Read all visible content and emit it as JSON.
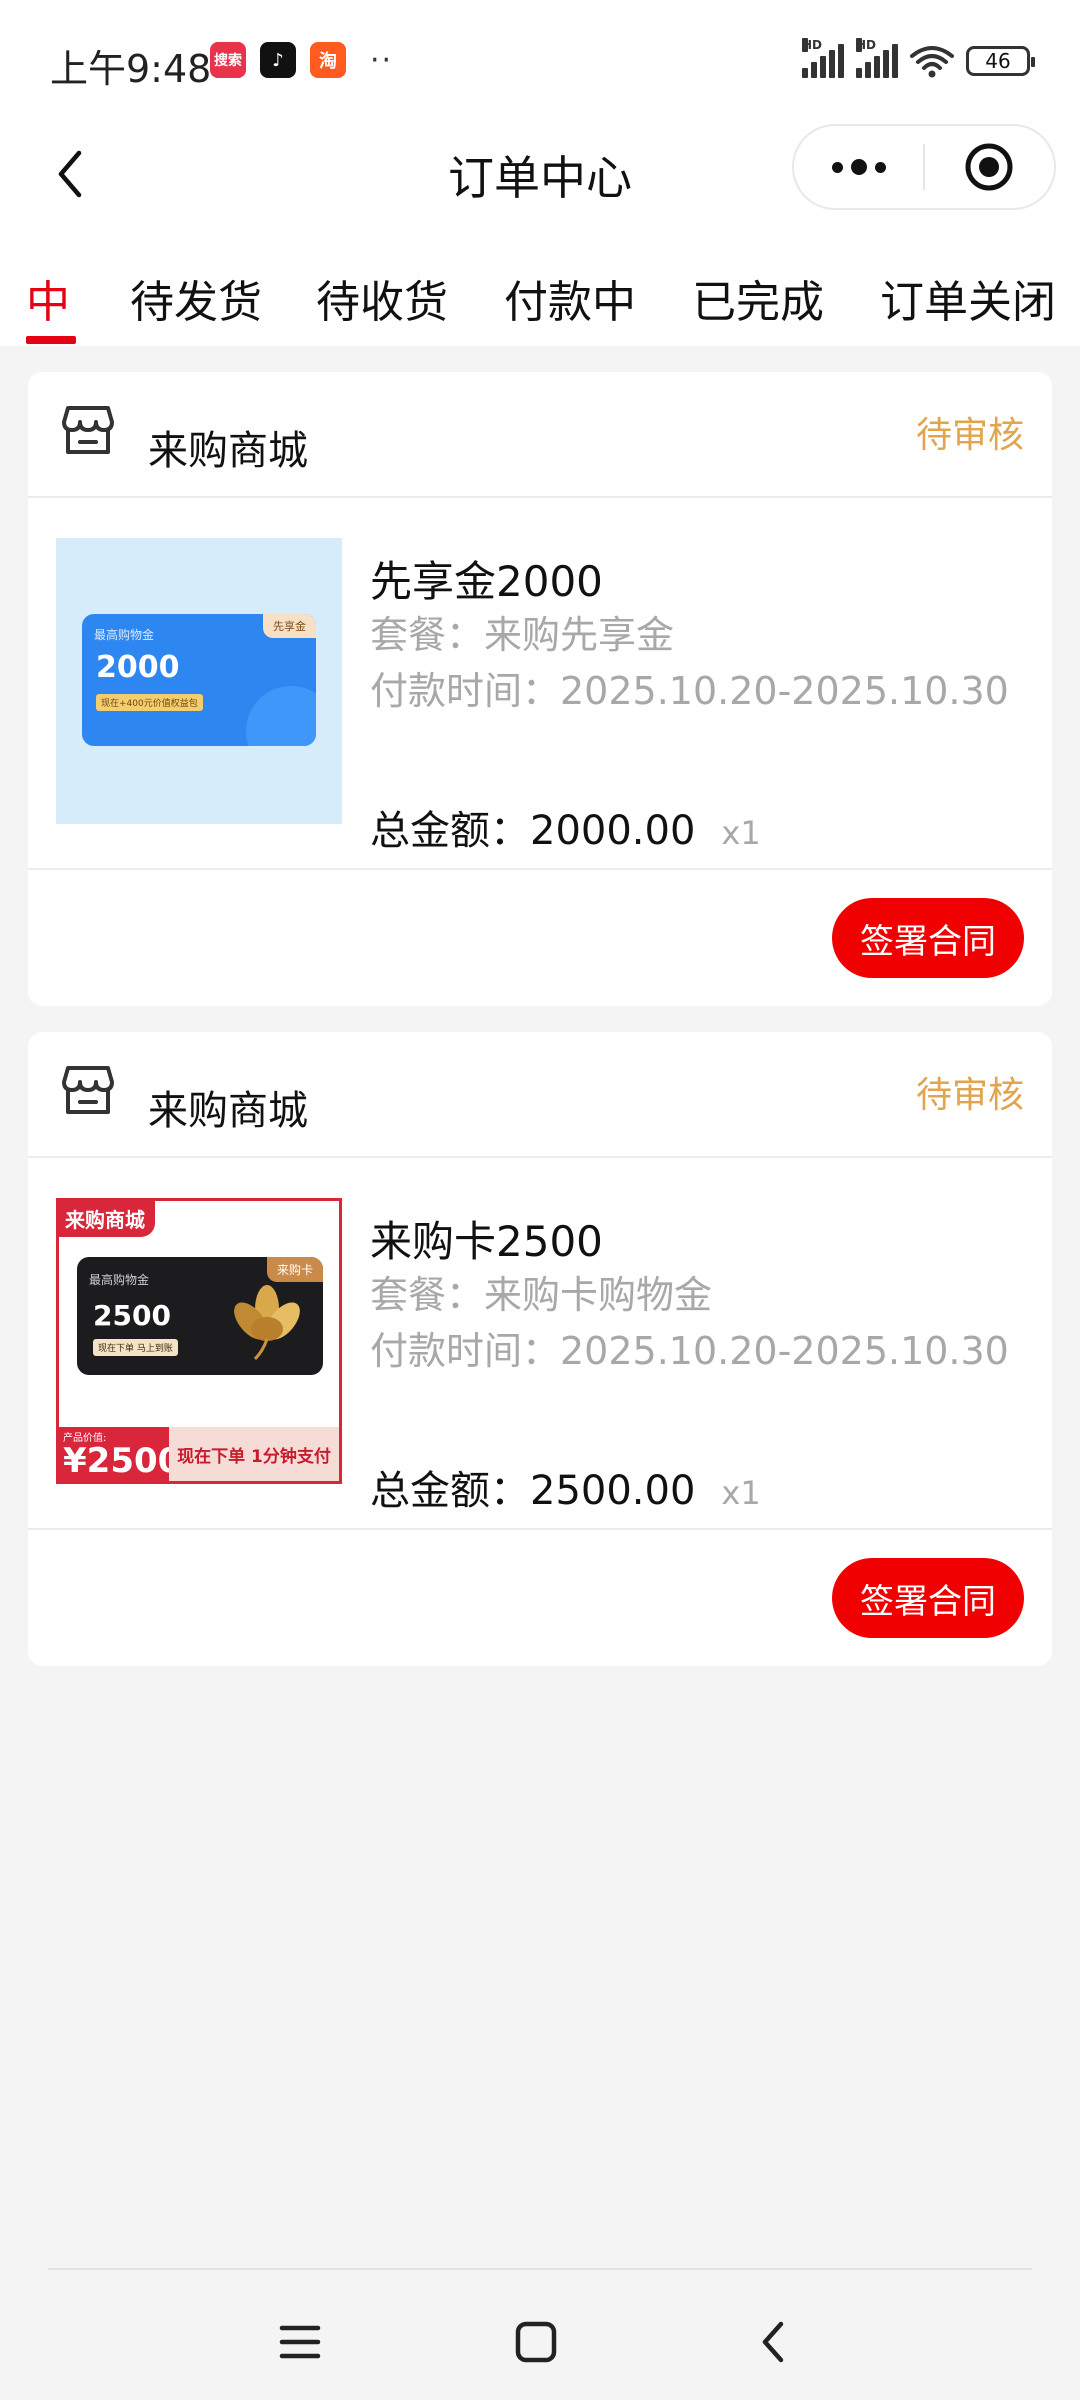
{
  "status_bar": {
    "time": "上午9:48",
    "apps": [
      {
        "icon": "search-app-icon",
        "label": "搜索",
        "color": "#e8334a"
      },
      {
        "icon": "tiktok-icon",
        "label": "♪",
        "color": "#111111"
      },
      {
        "icon": "taobao-icon",
        "label": "淘",
        "color": "#ff5a1f"
      }
    ],
    "more": "··",
    "signal1": "HD",
    "signal2": "HD",
    "battery": "46"
  },
  "header": {
    "back_icon": "back-chevron-icon",
    "title": "订单中心",
    "more_icon": "more-dots-icon",
    "target_icon": "target-circle-icon"
  },
  "tabs": [
    {
      "label": "中",
      "active": true
    },
    {
      "label": "待发货",
      "active": false
    },
    {
      "label": "待收货",
      "active": false
    },
    {
      "label": "付款中",
      "active": false
    },
    {
      "label": "已完成",
      "active": false
    },
    {
      "label": "订单关闭",
      "active": false
    }
  ],
  "orders": [
    {
      "store": "来购商城",
      "status": "待审核",
      "title": "先享金2000",
      "package": "套餐：来购先享金",
      "pay_time": "付款时间：2025.10.20-2025.10.30",
      "total": "总金额：2000.00",
      "qty": "x1",
      "action": "签署合同",
      "thumb": {
        "brand": "最高购物金",
        "amount": "2000",
        "strip": "现在+400元价值权益包",
        "tag": "先享金"
      }
    },
    {
      "store": "来购商城",
      "status": "待审核",
      "title": "来购卡2500",
      "package": "套餐：来购卡购物金",
      "pay_time": "付款时间：2025.10.20-2025.10.30",
      "total": "总金额：2500.00",
      "qty": "x1",
      "action": "签署合同",
      "thumb": {
        "corner": "来购商城",
        "brand": "最高购物金",
        "amount": "2500",
        "strip": "现在下单 马上到账",
        "tag": "来购卡",
        "price_label": "产品价值:",
        "price_value": "¥2500",
        "promo": "现在下单 1分钟支付"
      }
    }
  ],
  "colors": {
    "accent_red": "#e50012",
    "status_orange": "#e2a54f",
    "button_red": "#f00000"
  }
}
